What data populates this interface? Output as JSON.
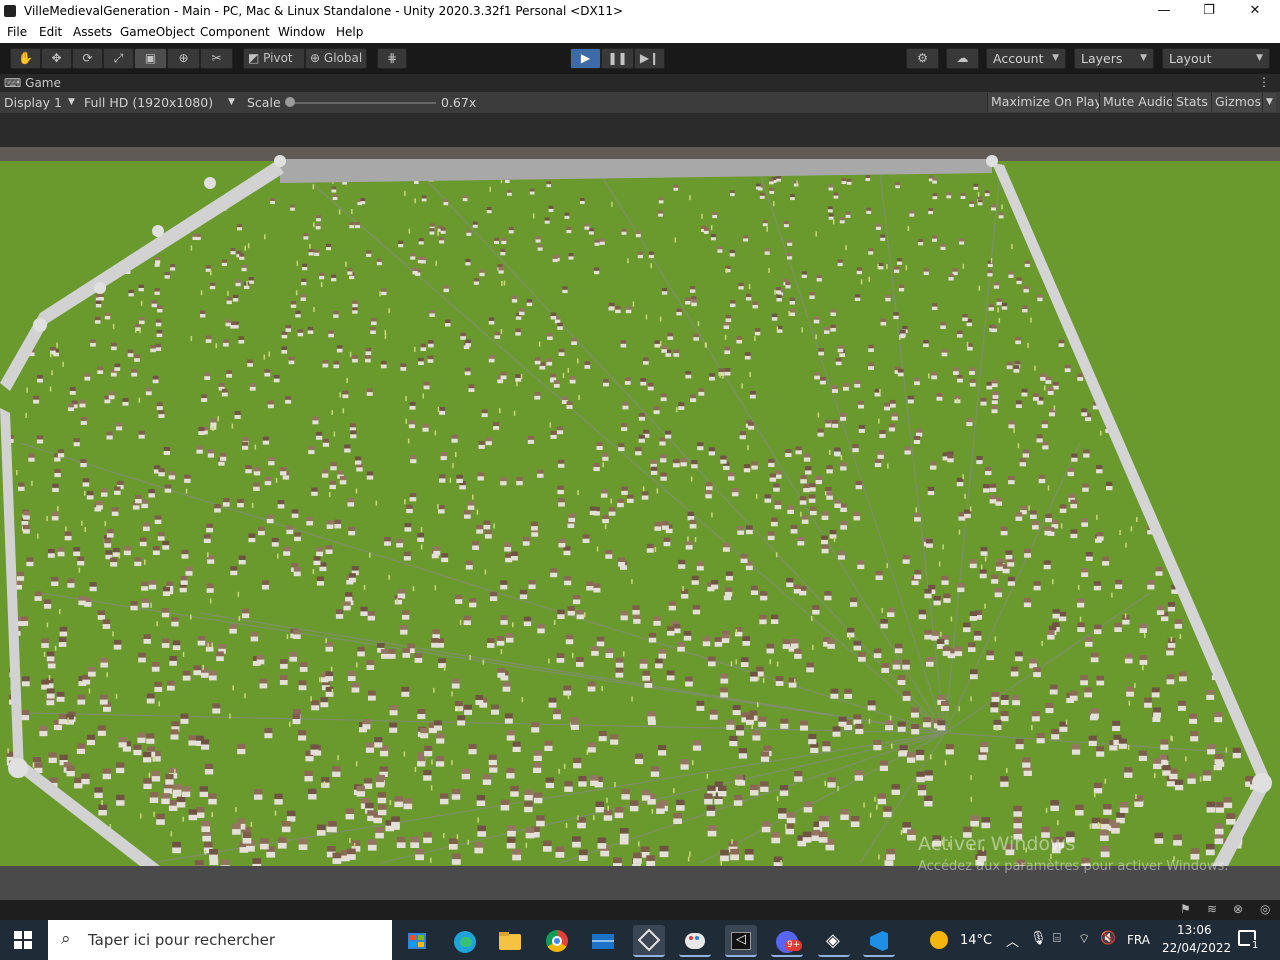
{
  "window": {
    "title": "VilleMedievalGeneration - Main - PC, Mac & Linux Standalone - Unity 2020.3.32f1 Personal <DX11>",
    "minimize": "—",
    "maximize": "❐",
    "close": "✕"
  },
  "menu": [
    "File",
    "Edit",
    "Assets",
    "GameObject",
    "Component",
    "Window",
    "Help"
  ],
  "toolbar": {
    "pivot_label": "Pivot",
    "global_label": "Global",
    "account_label": "Account",
    "layers_label": "Layers",
    "layout_label": "Layout"
  },
  "game_tab": {
    "label": "Game"
  },
  "game_bar": {
    "display": "Display 1",
    "resolution": "Full HD (1920x1080)",
    "scale_label": "Scale",
    "scale_value": "0.67x",
    "scale_fraction": 0.0,
    "maximize_on_play": "Maximize On Play",
    "mute_audio": "Mute Audio",
    "stats": "Stats",
    "gizmos": "Gizmos"
  },
  "watermark": {
    "line1": "Activer Windows",
    "line2": "Accédez aux paramètres pour activer Windows."
  },
  "taskbar": {
    "search_placeholder": "Taper ici pour rechercher",
    "weather_temp": "14°C",
    "language": "FRA",
    "time": "13:06",
    "date": "22/04/2022",
    "discord_badge": "9+",
    "notification_count": "1"
  },
  "colors": {
    "grass": "#6a9a2e",
    "wall": "#c9c9c9",
    "sky": "#5f5a55",
    "unity_blue": "#3d6ba8",
    "taskbar": "#1f2b36"
  }
}
